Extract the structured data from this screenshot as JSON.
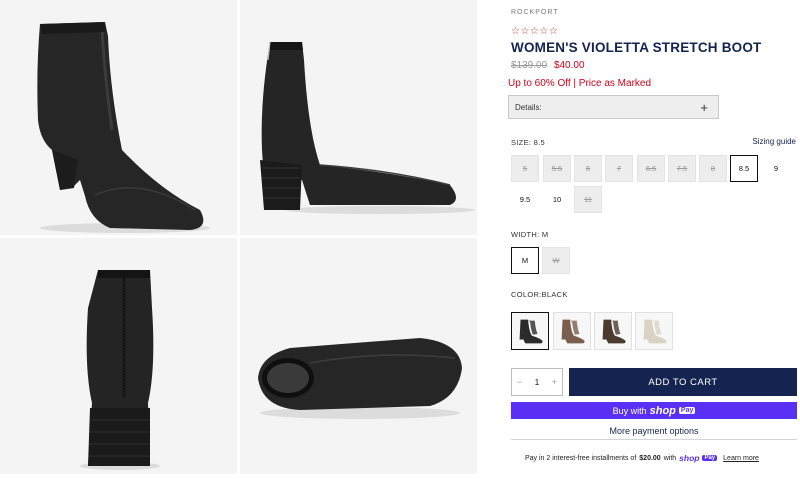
{
  "product": {
    "brand": "ROCKPORT",
    "rating_stars": "☆☆☆☆☆",
    "title": "WOMEN'S VIOLETTA STRETCH BOOT",
    "price_original": "$139.00",
    "price_sale": "$40.00",
    "promo": "Up to 60% Off | Price as Marked"
  },
  "details": {
    "label": "Details:",
    "toggle": "+"
  },
  "size": {
    "label": "SIZE: 8.5",
    "guide_label": "Sizing guide",
    "options": [
      {
        "label": "5",
        "state": "unavailable"
      },
      {
        "label": "5.5",
        "state": "unavailable"
      },
      {
        "label": "6",
        "state": "unavailable"
      },
      {
        "label": "7",
        "state": "unavailable"
      },
      {
        "label": "6.5",
        "state": "unavailable"
      },
      {
        "label": "7.5",
        "state": "unavailable"
      },
      {
        "label": "8",
        "state": "unavailable"
      },
      {
        "label": "8.5",
        "state": "selected"
      },
      {
        "label": "9",
        "state": "available"
      },
      {
        "label": "9.5",
        "state": "available"
      },
      {
        "label": "10",
        "state": "available"
      },
      {
        "label": "11",
        "state": "unavailable"
      }
    ]
  },
  "width": {
    "label": "WIDTH: M",
    "options": [
      {
        "label": "M",
        "state": "selected"
      },
      {
        "label": "W",
        "state": "unavailable"
      }
    ]
  },
  "color": {
    "label": "COLOR:BLACK",
    "swatches": [
      {
        "name": "black",
        "hex": "#2b2b2b",
        "selected": true
      },
      {
        "name": "taupe",
        "hex": "#7a5e4e",
        "selected": false
      },
      {
        "name": "dark-brown",
        "hex": "#4b3a2f",
        "selected": false
      },
      {
        "name": "cream",
        "hex": "#d9d3c6",
        "selected": false
      }
    ]
  },
  "cart": {
    "qty_minus": "−",
    "qty_value": "1",
    "qty_plus": "+",
    "add_label": "ADD TO CART"
  },
  "payment": {
    "shop_pay_prefix": "Buy with",
    "shop_word": "shop",
    "pay_badge": "Pay",
    "more_options": "More payment options",
    "installments_text": "Pay in 2 interest-free installments of",
    "installments_amount": "$20.00",
    "installments_with": "with",
    "learn_more": "Learn more"
  },
  "colors": {
    "navy": "#14234f",
    "sale_red": "#d0021b",
    "shop_purple": "#5a31f4"
  }
}
